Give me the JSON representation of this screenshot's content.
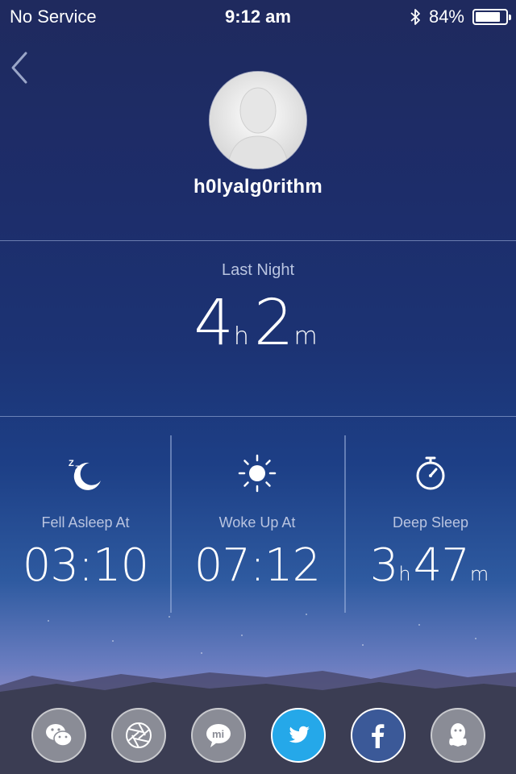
{
  "status_bar": {
    "carrier": "No Service",
    "time": "9:12 am",
    "battery": "84%",
    "battery_level": 0.84
  },
  "profile": {
    "username": "h0lyalg0rithm"
  },
  "summary": {
    "label": "Last Night",
    "hours": "4",
    "hours_unit": "h",
    "minutes": "2",
    "minutes_unit": "m"
  },
  "stats": [
    {
      "icon": "moon-zz-icon",
      "label": "Fell Asleep At",
      "value": "03:10"
    },
    {
      "icon": "sun-icon",
      "label": "Woke Up At",
      "value": "07:12"
    },
    {
      "icon": "stopwatch-icon",
      "label": "Deep Sleep",
      "hours": "3",
      "hours_unit": "h",
      "minutes": "47",
      "minutes_unit": "m"
    }
  ],
  "share": [
    {
      "icon": "wechat-icon",
      "service": "WeChat"
    },
    {
      "icon": "moments-icon",
      "service": "Moments"
    },
    {
      "icon": "mi-icon",
      "service": "Mi"
    },
    {
      "icon": "twitter-icon",
      "service": "Twitter",
      "color": "#25a8e9"
    },
    {
      "icon": "facebook-icon",
      "service": "Facebook",
      "color": "#3b5998"
    },
    {
      "icon": "qq-icon",
      "service": "QQ"
    }
  ]
}
